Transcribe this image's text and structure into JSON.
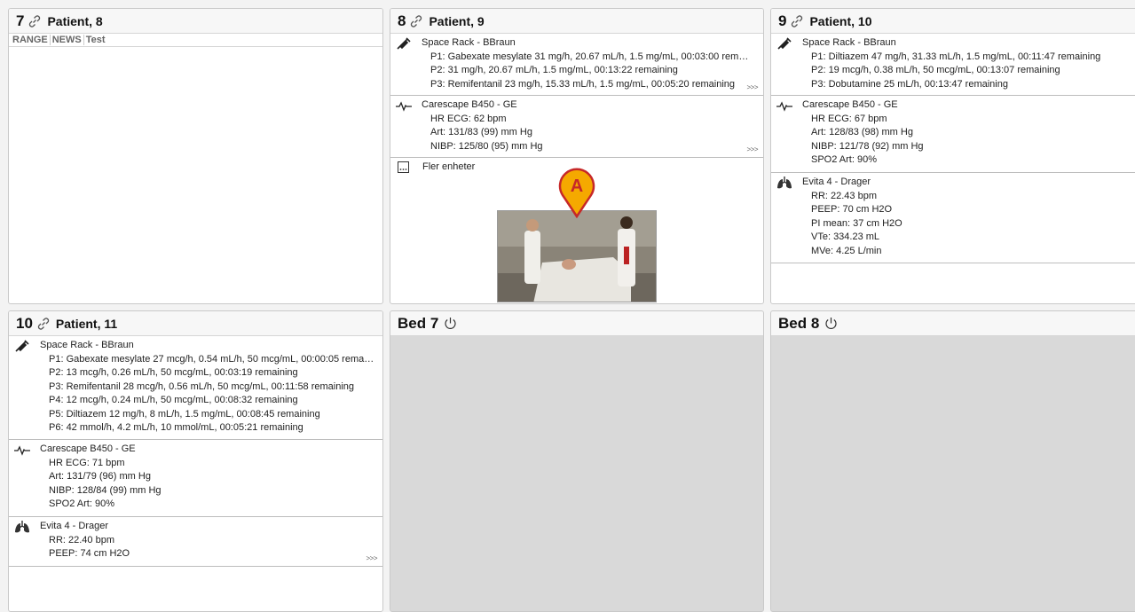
{
  "panels": {
    "p7": {
      "bed": "7",
      "name": "Patient, 8",
      "range": [
        "RANGE",
        "NEWS",
        "Test"
      ]
    },
    "p8": {
      "bed": "8",
      "name": "Patient, 9",
      "pump": {
        "name": "Space Rack - BBraun",
        "lines": [
          "P1: Gabexate mesylate 31 mg/h, 20.67 mL/h, 1.5 mg/mL, 00:03:00 remai…",
          "P2: 31 mg/h, 20.67 mL/h, 1.5 mg/mL, 00:13:22 remaining",
          "P3: Remifentanil 23 mg/h, 15.33 mL/h, 1.5 mg/mL, 00:05:20 remaining"
        ],
        "more": ">>>"
      },
      "monitor": {
        "name": "Carescape B450 - GE",
        "lines": [
          "HR ECG: 62 bpm",
          "Art: 131/83 (99) mm Hg",
          "NIBP: 125/80 (95) mm Hg"
        ],
        "more": ">>>"
      },
      "more_devices": "Fler enheter",
      "marker_label": "A"
    },
    "p9": {
      "bed": "9",
      "name": "Patient, 10",
      "pump": {
        "name": "Space Rack - BBraun",
        "lines": [
          "P1: Diltiazem 47 mg/h, 31.33 mL/h, 1.5 mg/mL, 00:11:47 remaining",
          "P2: 19 mcg/h, 0.38 mL/h, 50 mcg/mL, 00:13:07 remaining",
          "P3: Dobutamine 25 mL/h, 00:13:47 remaining"
        ]
      },
      "monitor": {
        "name": "Carescape B450 - GE",
        "lines": [
          "HR ECG: 67 bpm",
          "Art: 128/83 (98) mm Hg",
          "NIBP: 121/78 (92) mm Hg",
          "SPO2 Art: 90%"
        ]
      },
      "ventilator": {
        "name": "Evita 4 - Drager",
        "lines": [
          "RR: 22.43 bpm",
          "PEEP:  70 cm H2O",
          "PI mean: 37 cm H2O",
          "VTe: 334.23 mL",
          "MVe: 4.25 L/min"
        ]
      }
    },
    "p10": {
      "bed": "10",
      "name": "Patient, 11",
      "pump": {
        "name": "Space Rack - BBraun",
        "lines": [
          "P1: Gabexate mesylate 27 mcg/h, 0.54 mL/h, 50 mcg/mL, 00:00:05 rema…",
          "P2: 13 mcg/h, 0.26 mL/h, 50 mcg/mL, 00:03:19 remaining",
          "P3: Remifentanil 28 mcg/h, 0.56 mL/h, 50 mcg/mL, 00:11:58 remaining",
          "P4: 12 mcg/h, 0.24 mL/h, 50 mcg/mL, 00:08:32 remaining",
          "P5: Diltiazem 12 mg/h, 8 mL/h, 1.5 mg/mL, 00:08:45 remaining",
          "P6: 42 mmol/h, 4.2 mL/h, 10 mmol/mL, 00:05:21 remaining"
        ]
      },
      "monitor": {
        "name": "Carescape B450 - GE",
        "lines": [
          "HR ECG: 71 bpm",
          "Art: 131/79 (96) mm Hg",
          "NIBP: 128/84 (99) mm Hg",
          "SPO2 Art: 90%"
        ]
      },
      "ventilator": {
        "name": "Evita 4 - Drager",
        "lines": [
          "RR: 22.40 bpm",
          "PEEP:  74 cm H2O"
        ],
        "more": ">>>"
      }
    },
    "bed7": {
      "title": "Bed 7"
    },
    "bed8": {
      "title": "Bed 8"
    }
  },
  "icons": {
    "link": "link-icon",
    "pump": "syringe-icon",
    "monitor": "heartbeat-icon",
    "ventilator": "lungs-icon",
    "more_devices": "ellipsis-box-icon",
    "power": "power-icon"
  },
  "colors": {
    "marker": "#f5a900",
    "marker_border": "#c62828",
    "empty_bed": "#d9d9d9"
  }
}
